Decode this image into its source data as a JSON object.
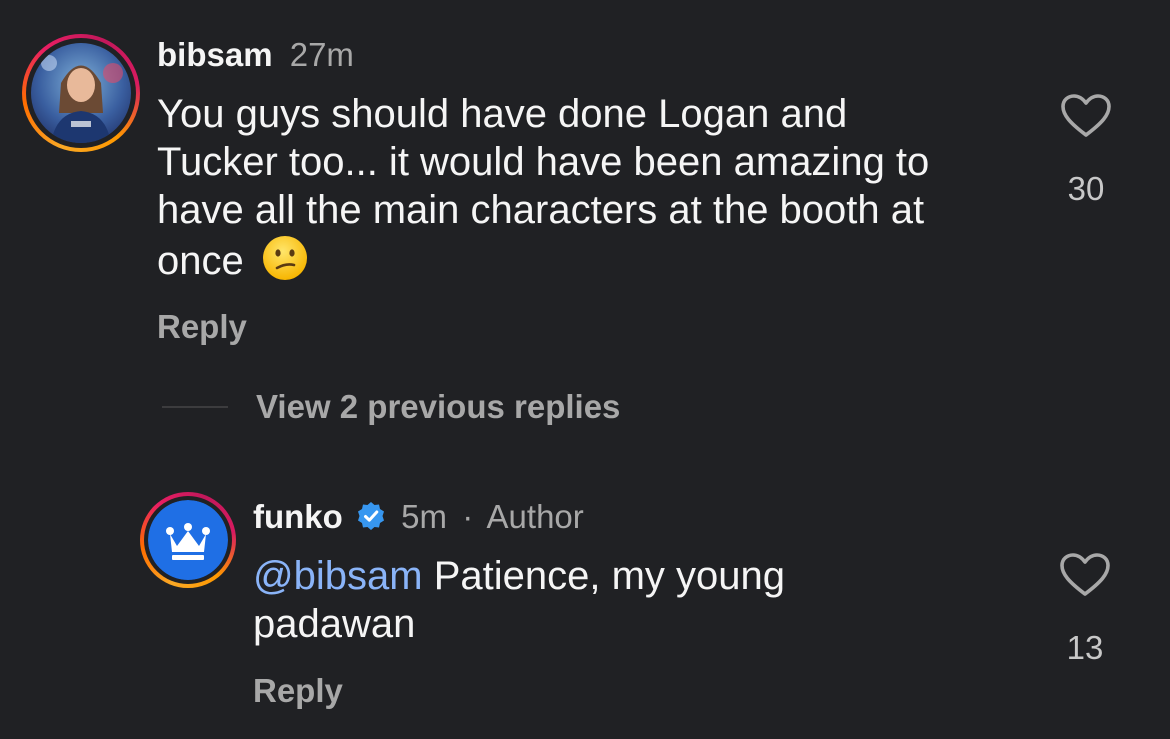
{
  "comments": [
    {
      "username": "bibsam",
      "time": "27m",
      "text": "You guys should have done Logan and Tucker too... it would have been amazing to have all the main characters at the booth at once",
      "text_lines": [
        "You guys should have done Logan and",
        "Tucker too... it would have been amazing to",
        "have all the main characters at the booth at",
        "once"
      ],
      "emoji": "confused-face",
      "reply_label": "Reply",
      "likes": "30"
    }
  ],
  "view_replies_label": "View 2 previous replies",
  "replies": [
    {
      "username": "funko",
      "verified": true,
      "time": "5m",
      "separator": "·",
      "author_label": "Author",
      "mention": "@bibsam",
      "text_lines": [
        "Patience, my young",
        "padawan"
      ],
      "reply_label": "Reply",
      "likes": "13"
    }
  ],
  "colors": {
    "background": "#202124",
    "mention": "#8ab4f8",
    "verified_badge": "#3797f0",
    "funko_avatar": "#1f6fe5"
  }
}
